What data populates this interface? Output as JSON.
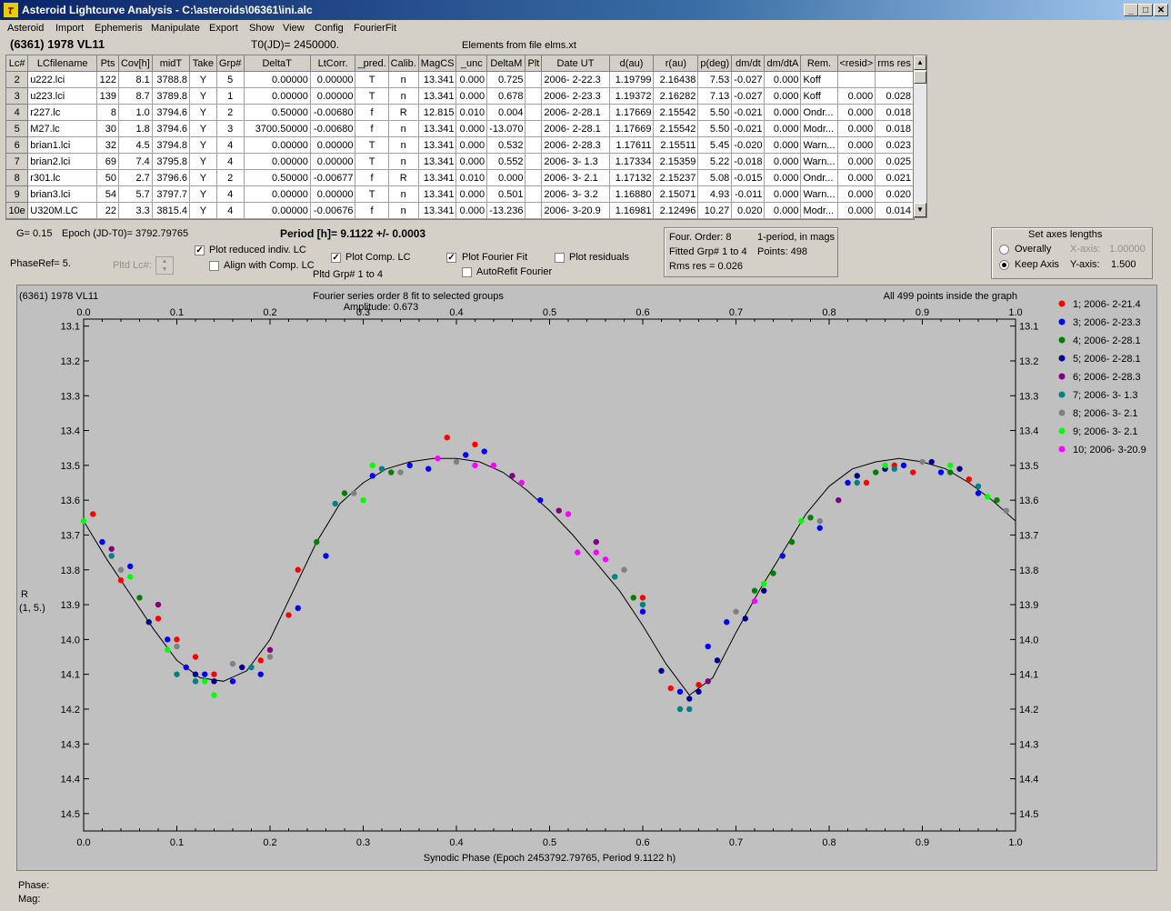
{
  "window": {
    "title": "Asteroid Lightcurve Analysis - C:\\asteroids\\06361\\ini.alc"
  },
  "menu": [
    "Asteroid",
    "Import",
    "Ephemeris",
    "Manipulate",
    "Export",
    "Show",
    "View",
    "Config",
    "FourierFit"
  ],
  "header": {
    "asteroid": "(6361) 1978 VL11",
    "t0": "T0(JD)= 2450000.",
    "elements": "Elements from file elms.xt"
  },
  "table": {
    "columns": [
      "Lc#",
      "LCfilename",
      "Pts",
      "Cov[h]",
      "midT",
      "Take",
      "Grp#",
      "DeltaT",
      "LtCorr.",
      "_pred.",
      "Calib.",
      "MagCS",
      "_unc",
      "DeltaM",
      "Plt",
      "Date UT",
      "d(au)",
      "r(au)",
      "p(deg)",
      "dm/dt",
      "dm/dtA",
      "Rem.",
      "<resid>",
      "rms res"
    ],
    "rows": [
      [
        "2",
        "u222.lci",
        "122",
        "8.1",
        "3788.8",
        "Y",
        "5",
        "0.00000",
        "0.00000",
        "T",
        "n",
        "13.341",
        "0.000",
        "0.725",
        "",
        "2006- 2-22.3",
        "1.19799",
        "2.16438",
        "7.53",
        "-0.027",
        "0.000",
        "Koff",
        "",
        ""
      ],
      [
        "3",
        "u223.lci",
        "139",
        "8.7",
        "3789.8",
        "Y",
        "1",
        "0.00000",
        "0.00000",
        "T",
        "n",
        "13.341",
        "0.000",
        "0.678",
        "",
        "2006- 2-23.3",
        "1.19372",
        "2.16282",
        "7.13",
        "-0.027",
        "0.000",
        "Koff",
        "0.000",
        "0.028"
      ],
      [
        "4",
        "r227.lc",
        "8",
        "1.0",
        "3794.6",
        "Y",
        "2",
        "0.50000",
        "-0.00680",
        "f",
        "R",
        "12.815",
        "0.010",
        "0.004",
        "",
        "2006- 2-28.1",
        "1.17669",
        "2.15542",
        "5.50",
        "-0.021",
        "0.000",
        "Ondr...",
        "0.000",
        "0.018"
      ],
      [
        "5",
        "M27.lc",
        "30",
        "1.8",
        "3794.6",
        "Y",
        "3",
        "3700.50000",
        "-0.00680",
        "f",
        "n",
        "13.341",
        "0.000",
        "-13.070",
        "",
        "2006- 2-28.1",
        "1.17669",
        "2.15542",
        "5.50",
        "-0.021",
        "0.000",
        "Modr...",
        "0.000",
        "0.018"
      ],
      [
        "6",
        "brian1.lci",
        "32",
        "4.5",
        "3794.8",
        "Y",
        "4",
        "0.00000",
        "0.00000",
        "T",
        "n",
        "13.341",
        "0.000",
        "0.532",
        "",
        "2006- 2-28.3",
        "1.17611",
        "2.15511",
        "5.45",
        "-0.020",
        "0.000",
        "Warn...",
        "0.000",
        "0.023"
      ],
      [
        "7",
        "brian2.lci",
        "69",
        "7.4",
        "3795.8",
        "Y",
        "4",
        "0.00000",
        "0.00000",
        "T",
        "n",
        "13.341",
        "0.000",
        "0.552",
        "",
        "2006- 3- 1.3",
        "1.17334",
        "2.15359",
        "5.22",
        "-0.018",
        "0.000",
        "Warn...",
        "0.000",
        "0.025"
      ],
      [
        "8",
        "r301.lc",
        "50",
        "2.7",
        "3796.6",
        "Y",
        "2",
        "0.50000",
        "-0.00677",
        "f",
        "R",
        "13.341",
        "0.010",
        "0.000",
        "",
        "2006- 3- 2.1",
        "1.17132",
        "2.15237",
        "5.08",
        "-0.015",
        "0.000",
        "Ondr...",
        "0.000",
        "0.021"
      ],
      [
        "9",
        "brian3.lci",
        "54",
        "5.7",
        "3797.7",
        "Y",
        "4",
        "0.00000",
        "0.00000",
        "T",
        "n",
        "13.341",
        "0.000",
        "0.501",
        "",
        "2006- 3- 3.2",
        "1.16880",
        "2.15071",
        "4.93",
        "-0.011",
        "0.000",
        "Warn...",
        "0.000",
        "0.020"
      ],
      [
        "10e",
        "U320M.LC",
        "22",
        "3.3",
        "3815.4",
        "Y",
        "4",
        "0.00000",
        "-0.00676",
        "f",
        "n",
        "13.341",
        "0.000",
        "-13.236",
        "",
        "2006- 3-20.9",
        "1.16981",
        "2.12496",
        "10.27",
        "0.020",
        "0.000",
        "Modr...",
        "0.000",
        "0.014"
      ]
    ]
  },
  "controls": {
    "g": "G= 0.15",
    "epoch": "Epoch (JD-T0)= 3792.79765",
    "period": "Period [h]= 9.1122 +/- 0.0003",
    "phaseref": "PhaseRef= 5.",
    "pltd_lc": "Pltd Lc#:",
    "plot_reduced": "Plot reduced indiv. LC",
    "align_comp": "Align with Comp. LC",
    "plot_comp": "Plot Comp. LC",
    "pltd_grp": "Pltd Grp#  1   to   4",
    "plot_fourier": "Plot Fourier Fit",
    "autorefit": "AutoRefit Fourier",
    "plot_residuals": "Plot residuals"
  },
  "fourier_info": {
    "order": "Four. Order:  8",
    "mode": "1-period, in mags",
    "fitted": "Fitted Grp# 1 to 4",
    "points": "Points: 498",
    "rms": "Rms res      = 0.026"
  },
  "axes_box": {
    "title": "Set axes lengths",
    "overally": "Overally",
    "keep_axis": "Keep Axis",
    "x_label": "X-axis:",
    "x_value": "1.00000",
    "y_label": "Y-axis:",
    "y_value": "1.500"
  },
  "chart_data": {
    "type": "scatter",
    "object_label": "(6361) 1978 VL11",
    "title": "Fourier series order 8 fit to selected groups",
    "subtitle": "Amplitude: 0.673",
    "info": "All 499 points inside the graph",
    "xlabel": "Synodic Phase (Epoch 2453792.79765, Period 9.1122 h)",
    "ylabel": [
      "R",
      "(1, 5.)"
    ],
    "xlim": [
      0.0,
      1.0
    ],
    "ylim": [
      14.55,
      13.08
    ],
    "xticks": [
      "0.0",
      "0.1",
      "0.2",
      "0.3",
      "0.4",
      "0.5",
      "0.6",
      "0.7",
      "0.8",
      "0.9",
      "1.0"
    ],
    "yticks": [
      "13.1",
      "13.2",
      "13.3",
      "13.4",
      "13.5",
      "13.6",
      "13.7",
      "13.8",
      "13.9",
      "14.0",
      "14.1",
      "14.2",
      "14.3",
      "14.4",
      "14.5"
    ],
    "grid": false,
    "legend_position": "right",
    "fit_curve": {
      "x": [
        0.0,
        0.025,
        0.05,
        0.075,
        0.1,
        0.125,
        0.15,
        0.175,
        0.2,
        0.225,
        0.25,
        0.275,
        0.3,
        0.325,
        0.35,
        0.375,
        0.4,
        0.425,
        0.45,
        0.475,
        0.5,
        0.525,
        0.55,
        0.575,
        0.6,
        0.625,
        0.65,
        0.675,
        0.7,
        0.725,
        0.75,
        0.775,
        0.8,
        0.825,
        0.85,
        0.875,
        0.9,
        0.925,
        0.95,
        0.975,
        1.0
      ],
      "y": [
        13.66,
        13.77,
        13.87,
        13.97,
        14.06,
        14.11,
        14.12,
        14.09,
        14.0,
        13.86,
        13.72,
        13.61,
        13.55,
        13.51,
        13.49,
        13.48,
        13.48,
        13.49,
        13.52,
        13.57,
        13.63,
        13.7,
        13.78,
        13.86,
        13.96,
        14.07,
        14.16,
        14.11,
        13.98,
        13.86,
        13.75,
        13.64,
        13.56,
        13.51,
        13.49,
        13.48,
        13.49,
        13.51,
        13.55,
        13.6,
        13.66
      ]
    },
    "series": [
      {
        "name": "1; 2006- 2-21.4",
        "color": "#ff0000",
        "x": [
          0.01,
          0.04,
          0.08,
          0.1,
          0.12,
          0.14,
          0.19,
          0.22,
          0.23,
          0.39,
          0.42,
          0.6,
          0.63,
          0.66,
          0.84,
          0.87,
          0.89,
          0.95
        ],
        "y": [
          13.64,
          13.83,
          13.94,
          14.0,
          14.05,
          14.1,
          14.06,
          13.93,
          13.8,
          13.42,
          13.44,
          13.88,
          14.14,
          14.13,
          13.55,
          13.5,
          13.52,
          13.54
        ]
      },
      {
        "name": "3; 2006- 2-23.3",
        "color": "#0000ff",
        "x": [
          0.02,
          0.05,
          0.09,
          0.11,
          0.13,
          0.16,
          0.19,
          0.23,
          0.26,
          0.31,
          0.35,
          0.37,
          0.41,
          0.43,
          0.49,
          0.6,
          0.64,
          0.67,
          0.69,
          0.75,
          0.79,
          0.82,
          0.88,
          0.92,
          0.96
        ],
        "y": [
          13.72,
          13.79,
          14.0,
          14.08,
          14.1,
          14.12,
          14.1,
          13.91,
          13.76,
          13.53,
          13.5,
          13.51,
          13.47,
          13.46,
          13.6,
          13.92,
          14.15,
          14.02,
          13.95,
          13.76,
          13.68,
          13.55,
          13.5,
          13.52,
          13.58
        ]
      },
      {
        "name": "4; 2006- 2-28.1",
        "color": "#008000",
        "x": [
          0.06,
          0.25,
          0.28,
          0.33,
          0.59,
          0.72,
          0.74,
          0.76,
          0.78,
          0.85,
          0.93,
          0.98
        ],
        "y": [
          13.88,
          13.72,
          13.58,
          13.52,
          13.88,
          13.86,
          13.81,
          13.72,
          13.65,
          13.52,
          13.52,
          13.6
        ]
      },
      {
        "name": "5; 2006- 2-28.1",
        "color": "#00008b",
        "x": [
          0.07,
          0.12,
          0.14,
          0.17,
          0.62,
          0.65,
          0.66,
          0.68,
          0.71,
          0.73,
          0.83,
          0.86,
          0.91,
          0.94
        ],
        "y": [
          13.95,
          14.1,
          14.12,
          14.08,
          14.09,
          14.17,
          14.15,
          14.06,
          13.94,
          13.86,
          13.53,
          13.51,
          13.49,
          13.51
        ]
      },
      {
        "name": "6; 2006- 2-28.3",
        "color": "#800080",
        "x": [
          0.03,
          0.08,
          0.2,
          0.46,
          0.51,
          0.55,
          0.67,
          0.81
        ],
        "y": [
          13.74,
          13.9,
          14.03,
          13.53,
          13.63,
          13.72,
          14.12,
          13.6
        ]
      },
      {
        "name": "7; 2006- 3- 1.3",
        "color": "#008080",
        "x": [
          0.03,
          0.1,
          0.12,
          0.18,
          0.27,
          0.32,
          0.57,
          0.6,
          0.64,
          0.65,
          0.83,
          0.87,
          0.96
        ],
        "y": [
          13.76,
          14.1,
          14.12,
          14.08,
          13.61,
          13.51,
          13.82,
          13.9,
          14.2,
          14.2,
          13.55,
          13.51,
          13.56
        ]
      },
      {
        "name": "8; 2006- 3- 2.1",
        "color": "#808080",
        "x": [
          0.04,
          0.1,
          0.16,
          0.2,
          0.29,
          0.34,
          0.4,
          0.58,
          0.7,
          0.79,
          0.9,
          0.99
        ],
        "y": [
          13.8,
          14.02,
          14.07,
          14.05,
          13.58,
          13.52,
          13.49,
          13.8,
          13.92,
          13.66,
          13.49,
          13.63
        ]
      },
      {
        "name": "9; 2006- 3- 2.1",
        "color": "#00ff00",
        "x": [
          0.0,
          0.05,
          0.09,
          0.13,
          0.14,
          0.3,
          0.31,
          0.47,
          0.73,
          0.77,
          0.86,
          0.93,
          0.97
        ],
        "y": [
          13.66,
          13.82,
          14.03,
          14.12,
          14.16,
          13.6,
          13.5,
          13.55,
          13.84,
          13.66,
          13.5,
          13.5,
          13.59
        ]
      },
      {
        "name": "10; 2006- 3-20.9",
        "color": "#ff00ff",
        "x": [
          0.38,
          0.42,
          0.44,
          0.47,
          0.52,
          0.53,
          0.55,
          0.56,
          0.72
        ],
        "y": [
          13.48,
          13.5,
          13.5,
          13.55,
          13.64,
          13.75,
          13.75,
          13.77,
          13.89
        ]
      }
    ]
  },
  "status": {
    "phase": "Phase:",
    "mag": "Mag:"
  }
}
